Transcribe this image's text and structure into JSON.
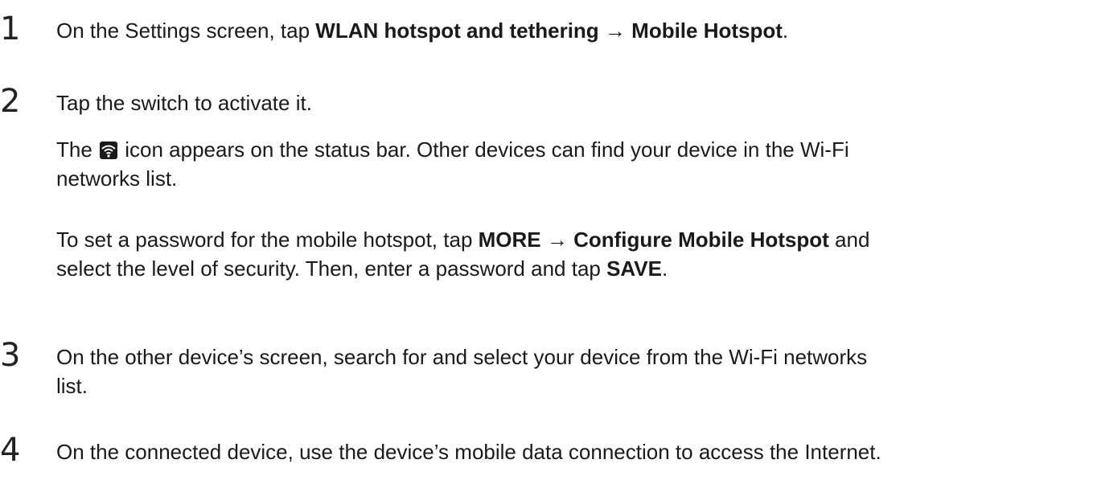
{
  "steps": [
    {
      "number": "1",
      "p1": {
        "t1": "On the Settings screen, tap ",
        "b1": "WLAN hotspot and tethering",
        "t2": " → ",
        "b2": "Mobile Hotspot",
        "t3": "."
      }
    },
    {
      "number": "2",
      "p1": {
        "t1": "Tap the switch to activate it."
      },
      "p2": {
        "t1": "The ",
        "icon": "wifi-hotspot-icon",
        "t2": " icon appears on the status bar. Other devices can find your device in the Wi-Fi",
        "line2": "networks list."
      },
      "p3": {
        "t1": "To set a password for the mobile hotspot, tap ",
        "b1": "MORE",
        "t2": " → ",
        "b2": "Configure Mobile Hotspot",
        "t3": " and",
        "line2a": "select the level of security. Then, enter a password and tap ",
        "b3": "SAVE",
        "line2b": "."
      }
    },
    {
      "number": "3",
      "p1": {
        "line1": "On the other device’s screen, search for and select your device from the Wi-Fi networks",
        "line2": "list."
      }
    },
    {
      "number": "4",
      "p1": {
        "t1": "On the connected device, use the device’s mobile data connection to access the Internet."
      }
    }
  ]
}
